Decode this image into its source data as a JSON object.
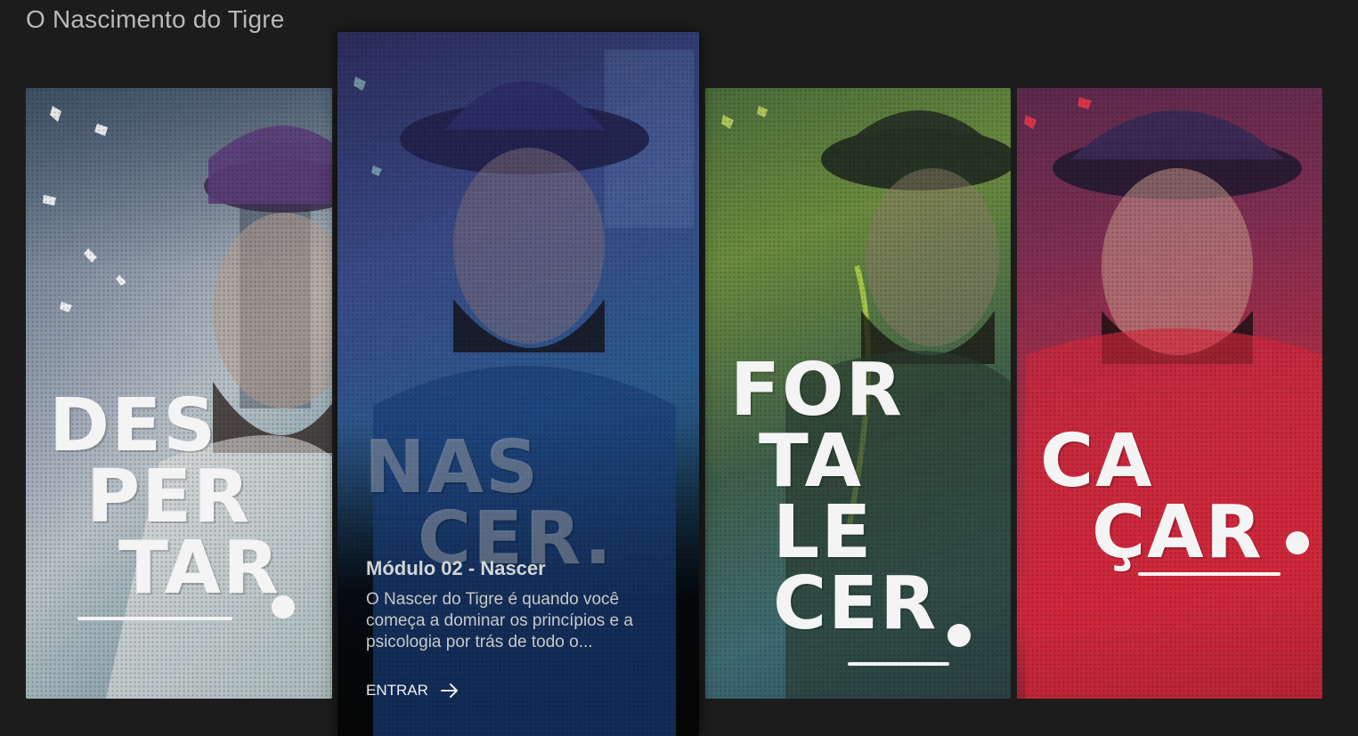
{
  "section": {
    "title": "O Nascimento do Tigre"
  },
  "cards": [
    {
      "poster_lines": [
        "DES",
        "PER",
        "TAR"
      ],
      "accent": "#8b96a6"
    },
    {
      "poster_lines": [
        "NAS",
        "CER."
      ],
      "accent": "#3a4a86",
      "module_title": "Módulo 02 - Nascer",
      "description": "O Nascer do Tigre é quando você começa a dominar os princípios e a psicologia por trás de todo o...",
      "enter_label": "ENTRAR",
      "enter_icon": "arrow-right-icon"
    },
    {
      "poster_lines": [
        "FOR",
        "TA",
        "LE",
        "CER"
      ],
      "accent": "#6b8b3e"
    },
    {
      "poster_lines": [
        "CA",
        "ÇAR"
      ],
      "accent": "#c9293d"
    }
  ],
  "colors": {
    "background": "#1c1c1c",
    "title_text": "#b9b9b9",
    "poster_text": "#f4f4f4"
  }
}
